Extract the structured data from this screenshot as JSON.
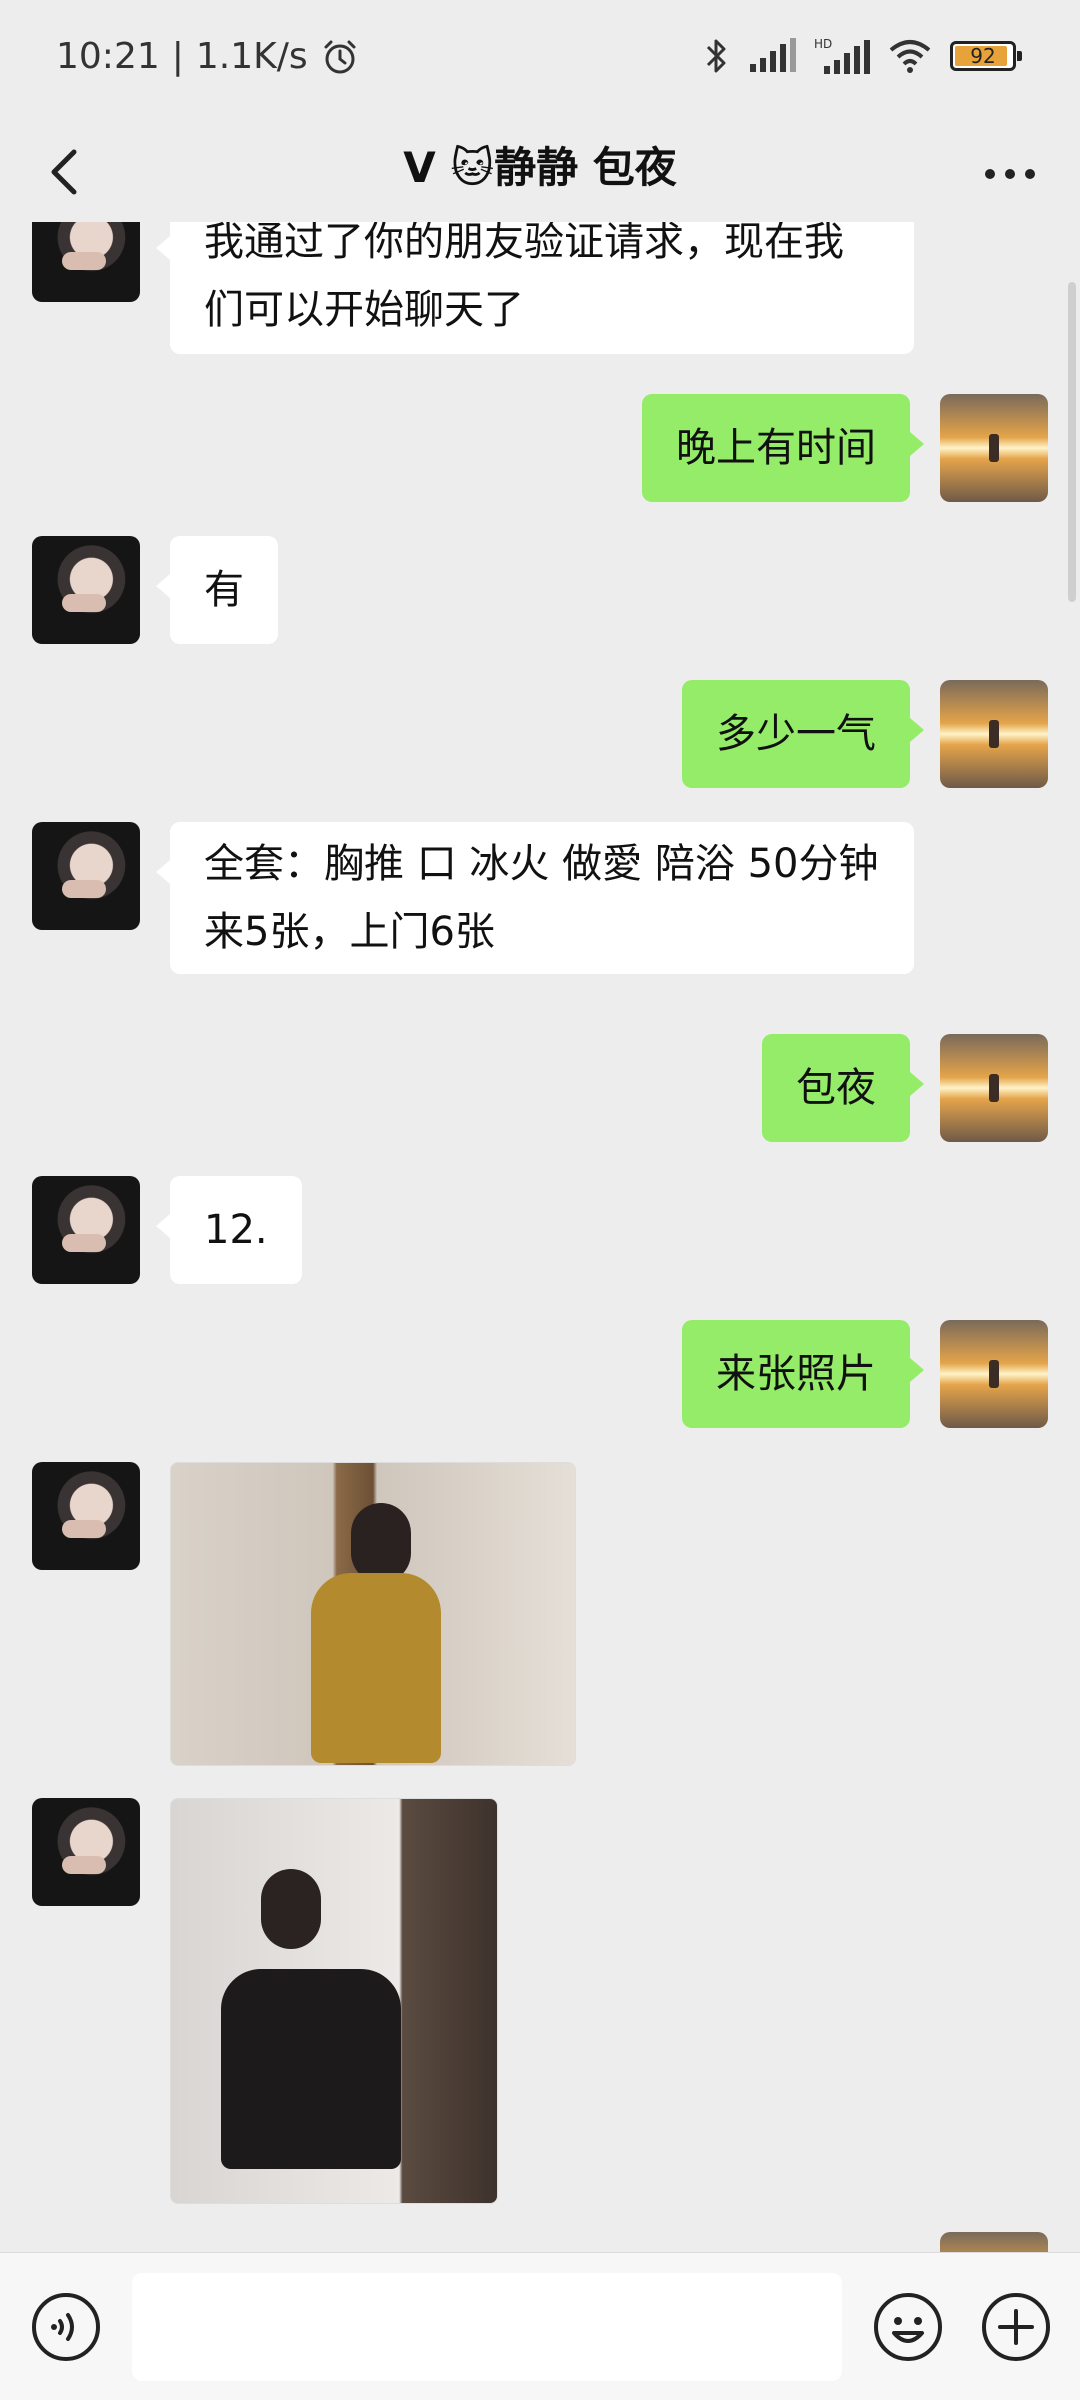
{
  "status_bar": {
    "time": "10:21",
    "speed": "1.1K/s",
    "battery_level": "92",
    "battery_fraction": 0.92,
    "battery_color": "#e8a23a",
    "icons": [
      "alarm-icon",
      "bluetooth-icon",
      "signal-icon",
      "hd-signal-icon",
      "wifi-icon",
      "battery-icon"
    ]
  },
  "nav": {
    "title": "V 🐱静静 包夜"
  },
  "messages": [
    {
      "side": "in",
      "type": "text",
      "text": "我通过了你的朋友验证请求，现在我们可以开始聊天了"
    },
    {
      "side": "out",
      "type": "text",
      "text": "晚上有时间"
    },
    {
      "side": "in",
      "type": "text",
      "text": "有"
    },
    {
      "side": "out",
      "type": "text",
      "text": "多少一气"
    },
    {
      "side": "in",
      "type": "text",
      "text": "全套：胸推  口  冰火  做愛  陪浴 50分钟  来5张，上门6张"
    },
    {
      "side": "out",
      "type": "text",
      "text": "包夜"
    },
    {
      "side": "in",
      "type": "text",
      "text": "12."
    },
    {
      "side": "out",
      "type": "text",
      "text": "来张照片"
    },
    {
      "side": "in",
      "type": "image"
    },
    {
      "side": "in",
      "type": "image"
    }
  ],
  "colors": {
    "background": "#ededed",
    "bubble_in": "#ffffff",
    "bubble_out": "#95ec69"
  }
}
